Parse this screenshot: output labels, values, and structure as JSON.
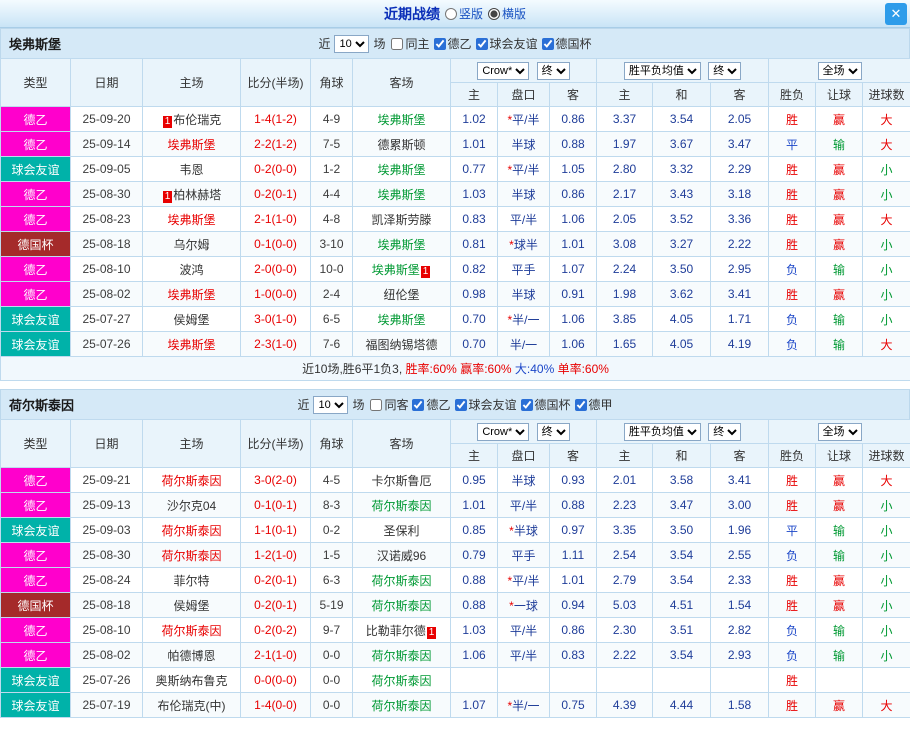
{
  "titlebar": {
    "title": "近期战绩",
    "view_vertical": "竖版",
    "view_horizontal": "横版",
    "view_selected": "横版",
    "close_glyph": "✕"
  },
  "columns": {
    "type": "类型",
    "date": "日期",
    "home": "主场",
    "score": "比分(半场)",
    "corner": "角球",
    "away": "客场",
    "odds_company": "Crow*",
    "odds_final": "终",
    "europe_label": "胜平负均值",
    "europe_final": "终",
    "scope_label": "全场",
    "sub": [
      "主",
      "盘口",
      "客",
      "主",
      "和",
      "客",
      "胜负",
      "让球",
      "进球数"
    ]
  },
  "colors": {
    "league": {
      "德乙": "#FF00CC",
      "球会友谊": "#00B2A9",
      "德国杯": "#A52A2A"
    },
    "focus_home": "#E80000",
    "focus_away": "#009933",
    "score": "#E80000",
    "odds": "#1F3D99",
    "win": "#E80000",
    "draw": "#1B46C8",
    "lose_text": "#009933"
  },
  "sections": [
    {
      "team": "埃弗斯堡",
      "near_prefix": "近",
      "near_count": "10",
      "near_suffix": "场",
      "filters": [
        {
          "label": "同主",
          "checked": false
        },
        {
          "label": "德乙",
          "checked": true
        },
        {
          "label": "球会友谊",
          "checked": true
        },
        {
          "label": "德国杯",
          "checked": true
        }
      ],
      "rows": [
        {
          "league": "德乙",
          "date": "25-09-20",
          "home": {
            "name": "布伦瑞克",
            "role": "opponent",
            "badge": "1",
            "badge_pos": "before"
          },
          "score": "1-4(1-2)",
          "corners": "4-9",
          "away": {
            "name": "埃弗斯堡",
            "role": "focus-away"
          },
          "asian": [
            "1.02",
            "*平/半",
            "0.86"
          ],
          "euro": [
            "3.37",
            "3.54",
            "2.05"
          ],
          "results": [
            [
              "胜",
              "r"
            ],
            [
              "赢",
              "r"
            ],
            [
              "大",
              "r"
            ]
          ]
        },
        {
          "league": "德乙",
          "date": "25-09-14",
          "home": {
            "name": "埃弗斯堡",
            "role": "focus-home"
          },
          "score": "2-2(1-2)",
          "corners": "7-5",
          "away": {
            "name": "德累斯顿",
            "role": "opponent"
          },
          "asian": [
            "1.01",
            "半球",
            "0.88"
          ],
          "euro": [
            "1.97",
            "3.67",
            "3.47"
          ],
          "results": [
            [
              "平",
              "b"
            ],
            [
              "输",
              "g"
            ],
            [
              "大",
              "r"
            ]
          ]
        },
        {
          "league": "球会友谊",
          "date": "25-09-05",
          "home": {
            "name": "韦恩",
            "role": "opponent"
          },
          "score": "0-2(0-0)",
          "corners": "1-2",
          "away": {
            "name": "埃弗斯堡",
            "role": "focus-away"
          },
          "asian": [
            "0.77",
            "*平/半",
            "1.05"
          ],
          "euro": [
            "2.80",
            "3.32",
            "2.29"
          ],
          "results": [
            [
              "胜",
              "r"
            ],
            [
              "赢",
              "r"
            ],
            [
              "小",
              "g"
            ]
          ]
        },
        {
          "league": "德乙",
          "date": "25-08-30",
          "home": {
            "name": "柏林赫塔",
            "role": "opponent",
            "badge": "1",
            "badge_pos": "before"
          },
          "score": "0-2(0-1)",
          "corners": "4-4",
          "away": {
            "name": "埃弗斯堡",
            "role": "focus-away"
          },
          "asian": [
            "1.03",
            "半球",
            "0.86"
          ],
          "euro": [
            "2.17",
            "3.43",
            "3.18"
          ],
          "results": [
            [
              "胜",
              "r"
            ],
            [
              "赢",
              "r"
            ],
            [
              "小",
              "g"
            ]
          ]
        },
        {
          "league": "德乙",
          "date": "25-08-23",
          "home": {
            "name": "埃弗斯堡",
            "role": "focus-home"
          },
          "score": "2-1(1-0)",
          "corners": "4-8",
          "away": {
            "name": "凯泽斯劳滕",
            "role": "opponent"
          },
          "asian": [
            "0.83",
            "平/半",
            "1.06"
          ],
          "euro": [
            "2.05",
            "3.52",
            "3.36"
          ],
          "results": [
            [
              "胜",
              "r"
            ],
            [
              "赢",
              "r"
            ],
            [
              "大",
              "r"
            ]
          ]
        },
        {
          "league": "德国杯",
          "date": "25-08-18",
          "home": {
            "name": "乌尔姆",
            "role": "opponent"
          },
          "score": "0-1(0-0)",
          "corners": "3-10",
          "away": {
            "name": "埃弗斯堡",
            "role": "focus-away"
          },
          "asian": [
            "0.81",
            "*球半",
            "1.01"
          ],
          "euro": [
            "3.08",
            "3.27",
            "2.22"
          ],
          "results": [
            [
              "胜",
              "r"
            ],
            [
              "赢",
              "r"
            ],
            [
              "小",
              "g"
            ]
          ]
        },
        {
          "league": "德乙",
          "date": "25-08-10",
          "home": {
            "name": "波鸿",
            "role": "opponent"
          },
          "score": "2-0(0-0)",
          "corners": "10-0",
          "away": {
            "name": "埃弗斯堡",
            "role": "focus-away",
            "badge": "1",
            "badge_pos": "after"
          },
          "asian": [
            "0.82",
            "平手",
            "1.07"
          ],
          "euro": [
            "2.24",
            "3.50",
            "2.95"
          ],
          "results": [
            [
              "负",
              "b"
            ],
            [
              "输",
              "g"
            ],
            [
              "小",
              "g"
            ]
          ]
        },
        {
          "league": "德乙",
          "date": "25-08-02",
          "home": {
            "name": "埃弗斯堡",
            "role": "focus-home"
          },
          "score": "1-0(0-0)",
          "corners": "2-4",
          "away": {
            "name": "纽伦堡",
            "role": "opponent"
          },
          "asian": [
            "0.98",
            "半球",
            "0.91"
          ],
          "euro": [
            "1.98",
            "3.62",
            "3.41"
          ],
          "results": [
            [
              "胜",
              "r"
            ],
            [
              "赢",
              "r"
            ],
            [
              "小",
              "g"
            ]
          ]
        },
        {
          "league": "球会友谊",
          "date": "25-07-27",
          "home": {
            "name": "侯姆堡",
            "role": "opponent"
          },
          "score": "3-0(1-0)",
          "corners": "6-5",
          "away": {
            "name": "埃弗斯堡",
            "role": "focus-away"
          },
          "asian": [
            "0.70",
            "*半/一",
            "1.06"
          ],
          "euro": [
            "3.85",
            "4.05",
            "1.71"
          ],
          "results": [
            [
              "负",
              "b"
            ],
            [
              "输",
              "g"
            ],
            [
              "小",
              "g"
            ]
          ]
        },
        {
          "league": "球会友谊",
          "date": "25-07-26",
          "home": {
            "name": "埃弗斯堡",
            "role": "focus-home"
          },
          "score": "2-3(1-0)",
          "corners": "7-6",
          "away": {
            "name": "福图纳锡塔德",
            "role": "opponent"
          },
          "asian": [
            "0.70",
            "半/一",
            "1.06"
          ],
          "euro": [
            "1.65",
            "4.05",
            "4.19"
          ],
          "results": [
            [
              "负",
              "b"
            ],
            [
              "输",
              "g"
            ],
            [
              "大",
              "r"
            ]
          ]
        }
      ],
      "summary": [
        {
          "text": "近10场,胜6平1负3, ",
          "cls": "k"
        },
        {
          "text": "胜率:60%",
          "cls": "r"
        },
        {
          "text": " 赢率:60%",
          "cls": "r"
        },
        {
          "text": " 大:40%",
          "cls": "b"
        },
        {
          "text": " 单率:60%",
          "cls": "r"
        }
      ]
    },
    {
      "team": "荷尔斯泰因",
      "near_prefix": "近",
      "near_count": "10",
      "near_suffix": "场",
      "filters": [
        {
          "label": "同客",
          "checked": false
        },
        {
          "label": "德乙",
          "checked": true
        },
        {
          "label": "球会友谊",
          "checked": true
        },
        {
          "label": "德国杯",
          "checked": true
        },
        {
          "label": "德甲",
          "checked": true
        }
      ],
      "rows": [
        {
          "league": "德乙",
          "date": "25-09-21",
          "home": {
            "name": "荷尔斯泰因",
            "role": "focus-home"
          },
          "score": "3-0(2-0)",
          "corners": "4-5",
          "away": {
            "name": "卡尔斯鲁厄",
            "role": "opponent"
          },
          "asian": [
            "0.95",
            "半球",
            "0.93"
          ],
          "euro": [
            "2.01",
            "3.58",
            "3.41"
          ],
          "results": [
            [
              "胜",
              "r"
            ],
            [
              "赢",
              "r"
            ],
            [
              "大",
              "r"
            ]
          ]
        },
        {
          "league": "德乙",
          "date": "25-09-13",
          "home": {
            "name": "沙尔克04",
            "role": "opponent"
          },
          "score": "0-1(0-1)",
          "corners": "8-3",
          "away": {
            "name": "荷尔斯泰因",
            "role": "focus-away"
          },
          "asian": [
            "1.01",
            "平/半",
            "0.88"
          ],
          "euro": [
            "2.23",
            "3.47",
            "3.00"
          ],
          "results": [
            [
              "胜",
              "r"
            ],
            [
              "赢",
              "r"
            ],
            [
              "小",
              "g"
            ]
          ]
        },
        {
          "league": "球会友谊",
          "date": "25-09-03",
          "home": {
            "name": "荷尔斯泰因",
            "role": "focus-home"
          },
          "score": "1-1(0-1)",
          "corners": "0-2",
          "away": {
            "name": "圣保利",
            "role": "opponent"
          },
          "asian": [
            "0.85",
            "*半球",
            "0.97"
          ],
          "euro": [
            "3.35",
            "3.50",
            "1.96"
          ],
          "results": [
            [
              "平",
              "b"
            ],
            [
              "输",
              "g"
            ],
            [
              "小",
              "g"
            ]
          ]
        },
        {
          "league": "德乙",
          "date": "25-08-30",
          "home": {
            "name": "荷尔斯泰因",
            "role": "focus-home"
          },
          "score": "1-2(1-0)",
          "corners": "1-5",
          "away": {
            "name": "汉诺威96",
            "role": "opponent"
          },
          "asian": [
            "0.79",
            "平手",
            "1.11"
          ],
          "euro": [
            "2.54",
            "3.54",
            "2.55"
          ],
          "results": [
            [
              "负",
              "b"
            ],
            [
              "输",
              "g"
            ],
            [
              "小",
              "g"
            ]
          ]
        },
        {
          "league": "德乙",
          "date": "25-08-24",
          "home": {
            "name": "菲尔特",
            "role": "opponent"
          },
          "score": "0-2(0-1)",
          "corners": "6-3",
          "away": {
            "name": "荷尔斯泰因",
            "role": "focus-away"
          },
          "asian": [
            "0.88",
            "*平/半",
            "1.01"
          ],
          "euro": [
            "2.79",
            "3.54",
            "2.33"
          ],
          "results": [
            [
              "胜",
              "r"
            ],
            [
              "赢",
              "r"
            ],
            [
              "小",
              "g"
            ]
          ]
        },
        {
          "league": "德国杯",
          "date": "25-08-18",
          "home": {
            "name": "侯姆堡",
            "role": "opponent"
          },
          "score": "0-2(0-1)",
          "corners": "5-19",
          "away": {
            "name": "荷尔斯泰因",
            "role": "focus-away"
          },
          "asian": [
            "0.88",
            "*一球",
            "0.94"
          ],
          "euro": [
            "5.03",
            "4.51",
            "1.54"
          ],
          "results": [
            [
              "胜",
              "r"
            ],
            [
              "赢",
              "r"
            ],
            [
              "小",
              "g"
            ]
          ]
        },
        {
          "league": "德乙",
          "date": "25-08-10",
          "home": {
            "name": "荷尔斯泰因",
            "role": "focus-home"
          },
          "score": "0-2(0-2)",
          "corners": "9-7",
          "away": {
            "name": "比勒菲尔德",
            "role": "opponent",
            "badge": "1",
            "badge_pos": "after"
          },
          "asian": [
            "1.03",
            "平/半",
            "0.86"
          ],
          "euro": [
            "2.30",
            "3.51",
            "2.82"
          ],
          "results": [
            [
              "负",
              "b"
            ],
            [
              "输",
              "g"
            ],
            [
              "小",
              "g"
            ]
          ]
        },
        {
          "league": "德乙",
          "date": "25-08-02",
          "home": {
            "name": "帕德博恩",
            "role": "opponent"
          },
          "score": "2-1(1-0)",
          "corners": "0-0",
          "away": {
            "name": "荷尔斯泰因",
            "role": "focus-away"
          },
          "asian": [
            "1.06",
            "平/半",
            "0.83"
          ],
          "euro": [
            "2.22",
            "3.54",
            "2.93"
          ],
          "results": [
            [
              "负",
              "b"
            ],
            [
              "输",
              "g"
            ],
            [
              "小",
              "g"
            ]
          ]
        },
        {
          "league": "球会友谊",
          "date": "25-07-26",
          "home": {
            "name": "奥斯纳布鲁克",
            "role": "opponent"
          },
          "score": "0-0(0-0)",
          "corners": "0-0",
          "away": {
            "name": "荷尔斯泰因",
            "role": "focus-away"
          },
          "asian": [
            "",
            "",
            ""
          ],
          "euro": [
            "",
            "",
            ""
          ],
          "results": [
            [
              "胜",
              "r"
            ],
            [
              "",
              ""
            ],
            [
              "",
              ""
            ]
          ]
        },
        {
          "league": "球会友谊",
          "date": "25-07-19",
          "home": {
            "name": "布伦瑞克(中)",
            "role": "opponent"
          },
          "score": "1-4(0-0)",
          "corners": "0-0",
          "away": {
            "name": "荷尔斯泰因",
            "role": "focus-away"
          },
          "asian": [
            "1.07",
            "*半/一",
            "0.75"
          ],
          "euro": [
            "4.39",
            "4.44",
            "1.58"
          ],
          "results": [
            [
              "胜",
              "r"
            ],
            [
              "赢",
              "r"
            ],
            [
              "大",
              "r"
            ]
          ]
        }
      ]
    }
  ]
}
